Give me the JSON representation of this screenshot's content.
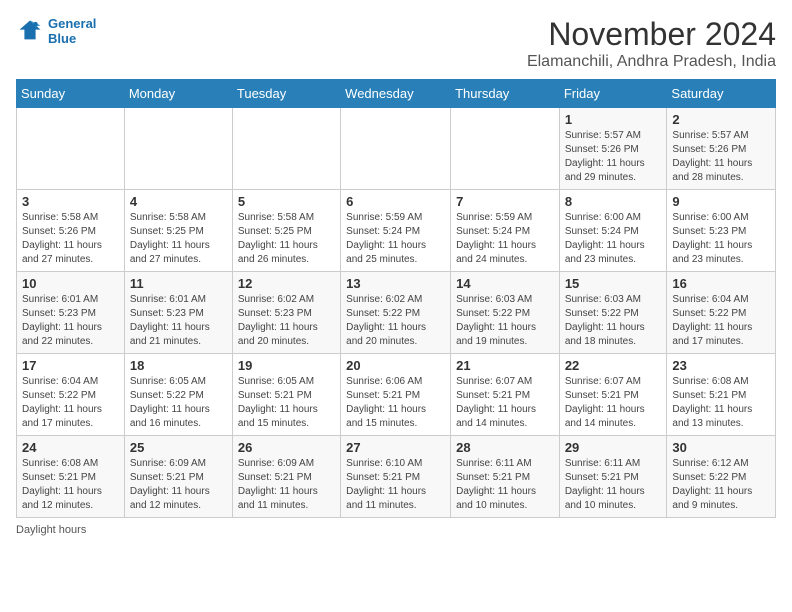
{
  "header": {
    "logo_line1": "General",
    "logo_line2": "Blue",
    "month": "November 2024",
    "location": "Elamanchili, Andhra Pradesh, India"
  },
  "weekdays": [
    "Sunday",
    "Monday",
    "Tuesday",
    "Wednesday",
    "Thursday",
    "Friday",
    "Saturday"
  ],
  "weeks": [
    [
      {
        "num": "",
        "info": ""
      },
      {
        "num": "",
        "info": ""
      },
      {
        "num": "",
        "info": ""
      },
      {
        "num": "",
        "info": ""
      },
      {
        "num": "",
        "info": ""
      },
      {
        "num": "1",
        "info": "Sunrise: 5:57 AM\nSunset: 5:26 PM\nDaylight: 11 hours and 29 minutes."
      },
      {
        "num": "2",
        "info": "Sunrise: 5:57 AM\nSunset: 5:26 PM\nDaylight: 11 hours and 28 minutes."
      }
    ],
    [
      {
        "num": "3",
        "info": "Sunrise: 5:58 AM\nSunset: 5:26 PM\nDaylight: 11 hours and 27 minutes."
      },
      {
        "num": "4",
        "info": "Sunrise: 5:58 AM\nSunset: 5:25 PM\nDaylight: 11 hours and 27 minutes."
      },
      {
        "num": "5",
        "info": "Sunrise: 5:58 AM\nSunset: 5:25 PM\nDaylight: 11 hours and 26 minutes."
      },
      {
        "num": "6",
        "info": "Sunrise: 5:59 AM\nSunset: 5:24 PM\nDaylight: 11 hours and 25 minutes."
      },
      {
        "num": "7",
        "info": "Sunrise: 5:59 AM\nSunset: 5:24 PM\nDaylight: 11 hours and 24 minutes."
      },
      {
        "num": "8",
        "info": "Sunrise: 6:00 AM\nSunset: 5:24 PM\nDaylight: 11 hours and 23 minutes."
      },
      {
        "num": "9",
        "info": "Sunrise: 6:00 AM\nSunset: 5:23 PM\nDaylight: 11 hours and 23 minutes."
      }
    ],
    [
      {
        "num": "10",
        "info": "Sunrise: 6:01 AM\nSunset: 5:23 PM\nDaylight: 11 hours and 22 minutes."
      },
      {
        "num": "11",
        "info": "Sunrise: 6:01 AM\nSunset: 5:23 PM\nDaylight: 11 hours and 21 minutes."
      },
      {
        "num": "12",
        "info": "Sunrise: 6:02 AM\nSunset: 5:23 PM\nDaylight: 11 hours and 20 minutes."
      },
      {
        "num": "13",
        "info": "Sunrise: 6:02 AM\nSunset: 5:22 PM\nDaylight: 11 hours and 20 minutes."
      },
      {
        "num": "14",
        "info": "Sunrise: 6:03 AM\nSunset: 5:22 PM\nDaylight: 11 hours and 19 minutes."
      },
      {
        "num": "15",
        "info": "Sunrise: 6:03 AM\nSunset: 5:22 PM\nDaylight: 11 hours and 18 minutes."
      },
      {
        "num": "16",
        "info": "Sunrise: 6:04 AM\nSunset: 5:22 PM\nDaylight: 11 hours and 17 minutes."
      }
    ],
    [
      {
        "num": "17",
        "info": "Sunrise: 6:04 AM\nSunset: 5:22 PM\nDaylight: 11 hours and 17 minutes."
      },
      {
        "num": "18",
        "info": "Sunrise: 6:05 AM\nSunset: 5:22 PM\nDaylight: 11 hours and 16 minutes."
      },
      {
        "num": "19",
        "info": "Sunrise: 6:05 AM\nSunset: 5:21 PM\nDaylight: 11 hours and 15 minutes."
      },
      {
        "num": "20",
        "info": "Sunrise: 6:06 AM\nSunset: 5:21 PM\nDaylight: 11 hours and 15 minutes."
      },
      {
        "num": "21",
        "info": "Sunrise: 6:07 AM\nSunset: 5:21 PM\nDaylight: 11 hours and 14 minutes."
      },
      {
        "num": "22",
        "info": "Sunrise: 6:07 AM\nSunset: 5:21 PM\nDaylight: 11 hours and 14 minutes."
      },
      {
        "num": "23",
        "info": "Sunrise: 6:08 AM\nSunset: 5:21 PM\nDaylight: 11 hours and 13 minutes."
      }
    ],
    [
      {
        "num": "24",
        "info": "Sunrise: 6:08 AM\nSunset: 5:21 PM\nDaylight: 11 hours and 12 minutes."
      },
      {
        "num": "25",
        "info": "Sunrise: 6:09 AM\nSunset: 5:21 PM\nDaylight: 11 hours and 12 minutes."
      },
      {
        "num": "26",
        "info": "Sunrise: 6:09 AM\nSunset: 5:21 PM\nDaylight: 11 hours and 11 minutes."
      },
      {
        "num": "27",
        "info": "Sunrise: 6:10 AM\nSunset: 5:21 PM\nDaylight: 11 hours and 11 minutes."
      },
      {
        "num": "28",
        "info": "Sunrise: 6:11 AM\nSunset: 5:21 PM\nDaylight: 11 hours and 10 minutes."
      },
      {
        "num": "29",
        "info": "Sunrise: 6:11 AM\nSunset: 5:21 PM\nDaylight: 11 hours and 10 minutes."
      },
      {
        "num": "30",
        "info": "Sunrise: 6:12 AM\nSunset: 5:22 PM\nDaylight: 11 hours and 9 minutes."
      }
    ]
  ],
  "footer": "Daylight hours"
}
